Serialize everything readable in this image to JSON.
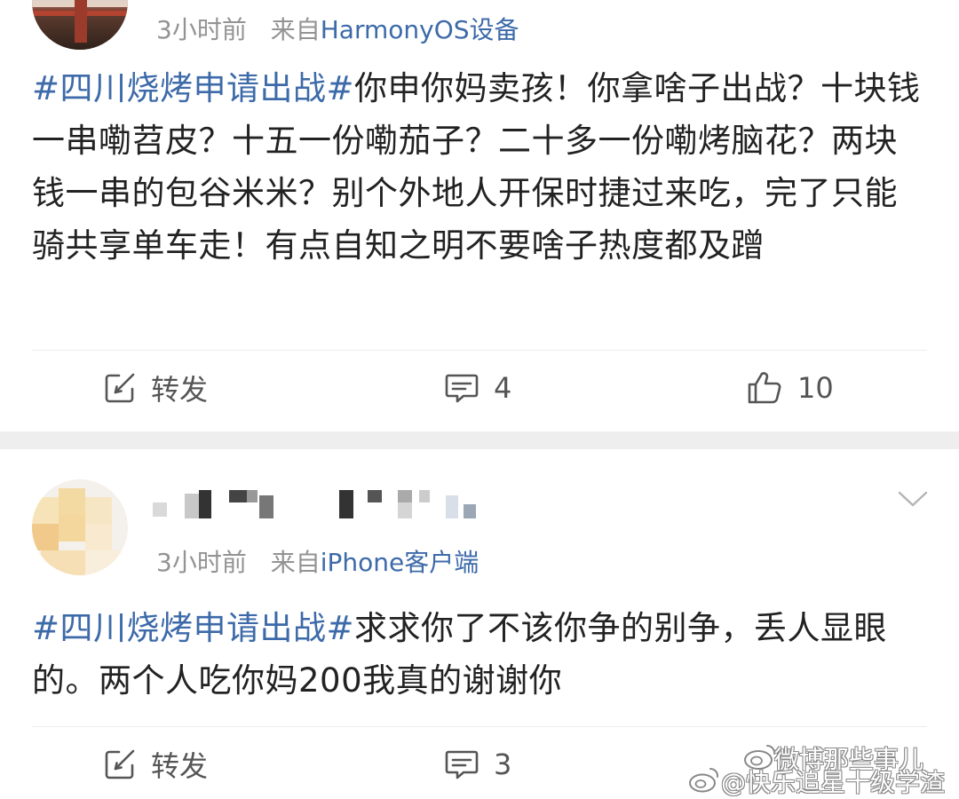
{
  "posts": [
    {
      "time": "3小时前",
      "source_prefix": "来自",
      "device": "HarmonyOS设备",
      "hashtag": "#四川烧烤申请出战#",
      "text": "你申你妈卖孩！你拿啥子出战？十块钱一串嘞苕皮？十五一份嘞茄子？二十多一份嘞烤脑花？两块钱一串的包谷米米？别个外地人开保时捷过来吃，完了只能骑共享单车走！有点自知之明不要啥子热度都及蹭",
      "actions": {
        "repost_label": "转发",
        "comment_count": "4",
        "like_count": "10"
      }
    },
    {
      "time": "3小时前",
      "source_prefix": "来自",
      "device": "iPhone客户端",
      "hashtag": "#四川烧烤申请出战#",
      "text": "求求你了不该你争的别争，丢人显眼的。两个人吃你妈200我真的谢谢你",
      "actions": {
        "repost_label": "转发",
        "comment_count": "3"
      }
    }
  ],
  "watermark": {
    "line1": "微博那些事儿",
    "line2": "@快乐追星十级学渣"
  },
  "icons": {
    "repost": "repost-icon",
    "comment": "comment-icon",
    "like": "thumbs-up-icon",
    "more": "chevron-down-icon"
  },
  "colors": {
    "link": "#3d6aa9",
    "meta": "#939393",
    "text": "#222222",
    "separator": "#eeeeee"
  }
}
